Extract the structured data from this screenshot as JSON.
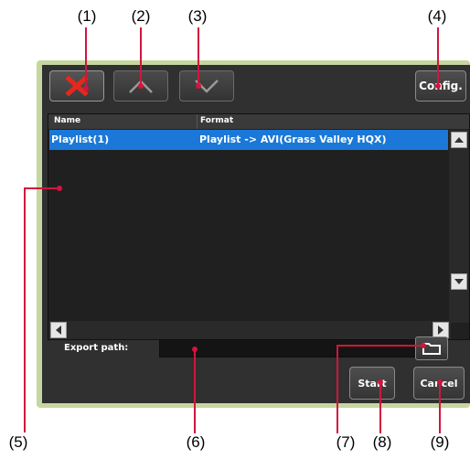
{
  "callouts": [
    "(1)",
    "(2)",
    "(3)",
    "(4)",
    "(5)",
    "(6)",
    "(7)",
    "(8)",
    "(9)"
  ],
  "toolbar": {
    "delete_icon": "close-x-icon",
    "up_icon": "chevron-up-icon",
    "down_icon": "chevron-down-icon",
    "config_label": "Config."
  },
  "list": {
    "columns": [
      "Name",
      "Format"
    ],
    "rows": [
      {
        "name": "Playlist(1)",
        "format": "Playlist -> AVI(Grass Valley HQX)"
      }
    ]
  },
  "export": {
    "label": "Export path:",
    "value": ""
  },
  "actions": {
    "start": "Start",
    "cancel": "Cancel"
  },
  "colors": {
    "frame": "#c5d7a0",
    "panel": "#303030",
    "selection": "#1b78d8",
    "leader": "#d4143c",
    "delete_icon": "#e8271c"
  }
}
